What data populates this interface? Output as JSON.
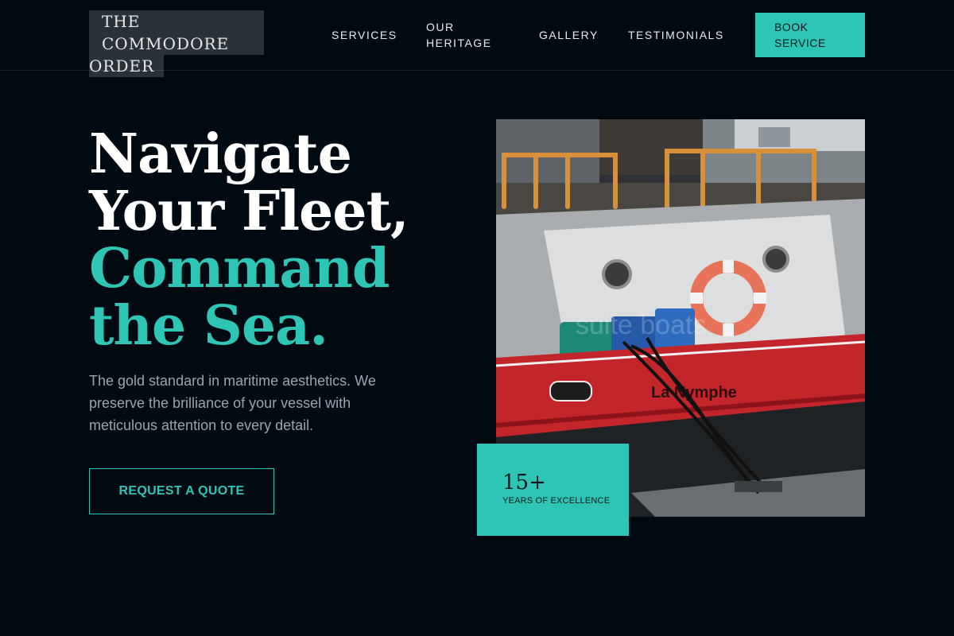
{
  "brand": {
    "line1": "THE COMMODORE",
    "line2": "ORDER",
    "accent_color": "#2ec4b6",
    "background_color": "#020a11"
  },
  "nav": {
    "services": "SERVICES",
    "heritage": "OUR HERITAGE",
    "gallery": "GALLERY",
    "testimonials": "TESTIMONIALS",
    "cta": "BOOK SERVICE"
  },
  "hero": {
    "title_line1": "Navigate Your Fleet,",
    "title_line2": "Command the Sea.",
    "subtitle": "The gold standard in maritime aesthetics. We preserve the brilliance of your vessel with meticulous attention to every detail.",
    "cta": "REQUEST A QUOTE"
  },
  "image": {
    "boat_name": "La Nymphe",
    "watermark": "suite boats"
  },
  "badge": {
    "number": "15+",
    "label": "YEARS OF EXCELLENCE"
  }
}
